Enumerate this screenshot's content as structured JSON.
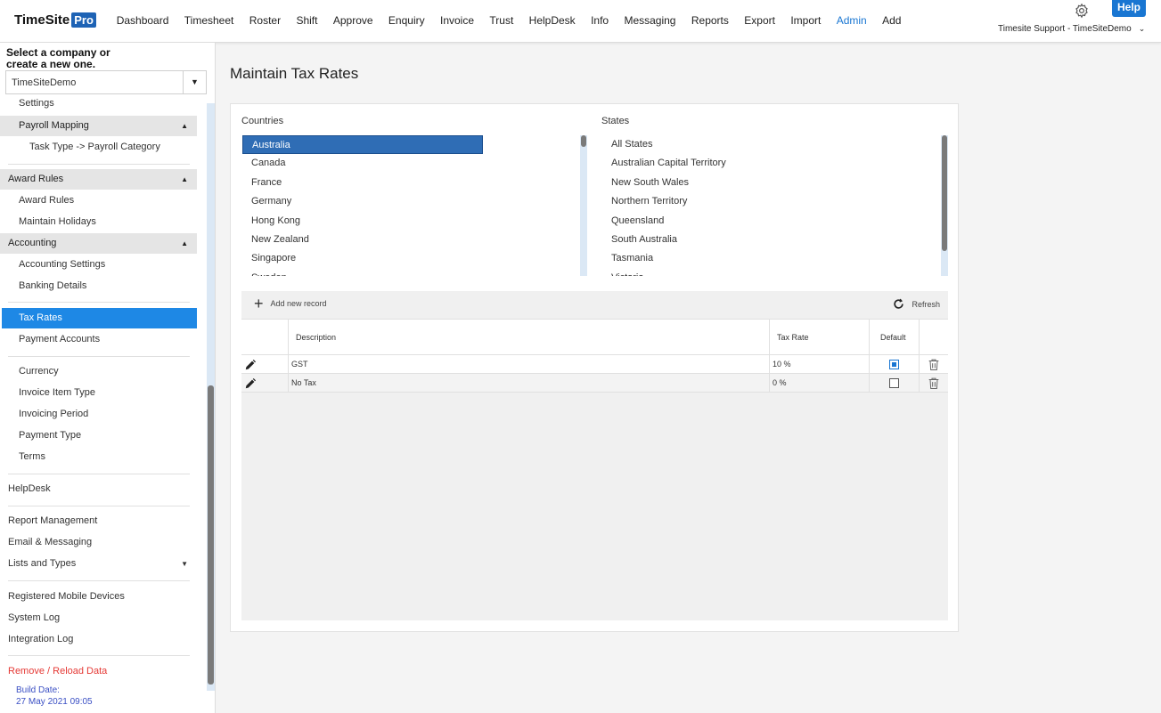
{
  "brand": {
    "name": "TimeSite",
    "badge": "Pro"
  },
  "nav": [
    "Dashboard",
    "Timesheet",
    "Roster",
    "Shift",
    "Approve",
    "Enquiry",
    "Invoice",
    "Trust",
    "HelpDesk",
    "Info",
    "Messaging",
    "Reports",
    "Export",
    "Import",
    "Admin",
    "Add"
  ],
  "nav_active": "Admin",
  "header": {
    "help_label": "Help",
    "user_label": "Timesite Support - TimeSiteDemo"
  },
  "sidebar": {
    "prompt_line1": "Select a company or",
    "prompt_line2": "create a new one.",
    "company": "TimeSiteDemo",
    "items": {
      "settings": "Settings",
      "payroll_mapping": "Payroll Mapping",
      "task_type": "Task Type -> Payroll Category",
      "award_rules_head": "Award Rules",
      "award_rules": "Award Rules",
      "maintain_holidays": "Maintain Holidays",
      "accounting_head": "Accounting",
      "accounting_settings": "Accounting Settings",
      "banking_details": "Banking Details",
      "tax_rates": "Tax Rates",
      "payment_accounts": "Payment Accounts",
      "currency": "Currency",
      "invoice_item_type": "Invoice Item Type",
      "invoicing_period": "Invoicing Period",
      "payment_type": "Payment Type",
      "terms": "Terms",
      "helpdesk": "HelpDesk",
      "report_management": "Report Management",
      "email_messaging": "Email & Messaging",
      "lists_and_types": "Lists and Types",
      "registered_mobile": "Registered Mobile Devices",
      "system_log": "System Log",
      "integration_log": "Integration Log",
      "remove_reload": "Remove / Reload Data"
    },
    "build_label": "Build Date:",
    "build_date": "27 May 2021 09:05"
  },
  "main": {
    "title": "Maintain Tax Rates",
    "countries_label": "Countries",
    "countries": [
      "Australia",
      "Canada",
      "France",
      "Germany",
      "Hong Kong",
      "New Zealand",
      "Singapore",
      "Sweden"
    ],
    "selected_country": "Australia",
    "states_label": "States",
    "states": [
      "All States",
      "Australian Capital Territory",
      "New South Wales",
      "Northern Territory",
      "Queensland",
      "South Australia",
      "Tasmania",
      "Victoria"
    ],
    "toolbar": {
      "add_label": "Add new record",
      "refresh_label": "Refresh"
    },
    "columns": {
      "description": "Description",
      "tax_rate": "Tax Rate",
      "default": "Default"
    },
    "rows": [
      {
        "description": "GST",
        "tax_rate": "10 %",
        "default": true
      },
      {
        "description": "No Tax",
        "tax_rate": "0 %",
        "default": false
      }
    ]
  },
  "colors": {
    "accent": "#1976d2",
    "selected": "#1e88e5",
    "danger": "#e53935",
    "build": "#3a4fc4"
  },
  "icons": [
    "gear-icon",
    "chevron-down-icon",
    "plus-icon",
    "refresh-icon",
    "pencil-icon",
    "trash-icon",
    "triangle-up-icon",
    "triangle-down-icon"
  ]
}
